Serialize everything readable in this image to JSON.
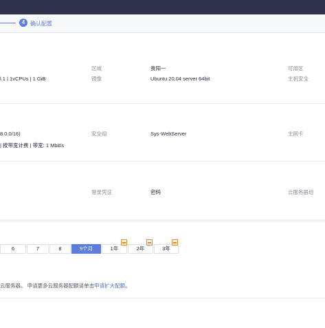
{
  "steps": {
    "current_number": "4",
    "current_label": "确认配置"
  },
  "config": {
    "row1": {
      "flavor_value": "l.1 | 1vCPUs | 1 GiB",
      "region_label": "区域",
      "region_value": "贵阳一",
      "image_label": "镜像",
      "image_value": "Ubuntu 20.04 server 64bit",
      "az_label": "可用区",
      "security_label": "主机安全"
    },
    "row2": {
      "vpc_value": "8.0.0/16)",
      "bandwidth_value": "| 按带宽计费 | 带宽: 1 Mbit/s",
      "sg_label": "安全组",
      "sg_value": "Sys-WebServer",
      "nic_label": "主网卡"
    },
    "row3": {
      "login_label": "登录凭证",
      "login_value": "密码",
      "group_label": "云服务器组"
    }
  },
  "purchase": {
    "periods": [
      "6",
      "7",
      "8",
      "9个月",
      "1年",
      "2年",
      "3年"
    ],
    "selected_period": "9个月",
    "notice_text": "云服务器。 申请更多云服务器配额请单击",
    "notice_link": "申请扩大配额",
    "notice_end": "。"
  },
  "colors": {
    "accent": "#5e7ce0",
    "topbar": "#2e3349",
    "promo_badge": "#e08a2c"
  }
}
